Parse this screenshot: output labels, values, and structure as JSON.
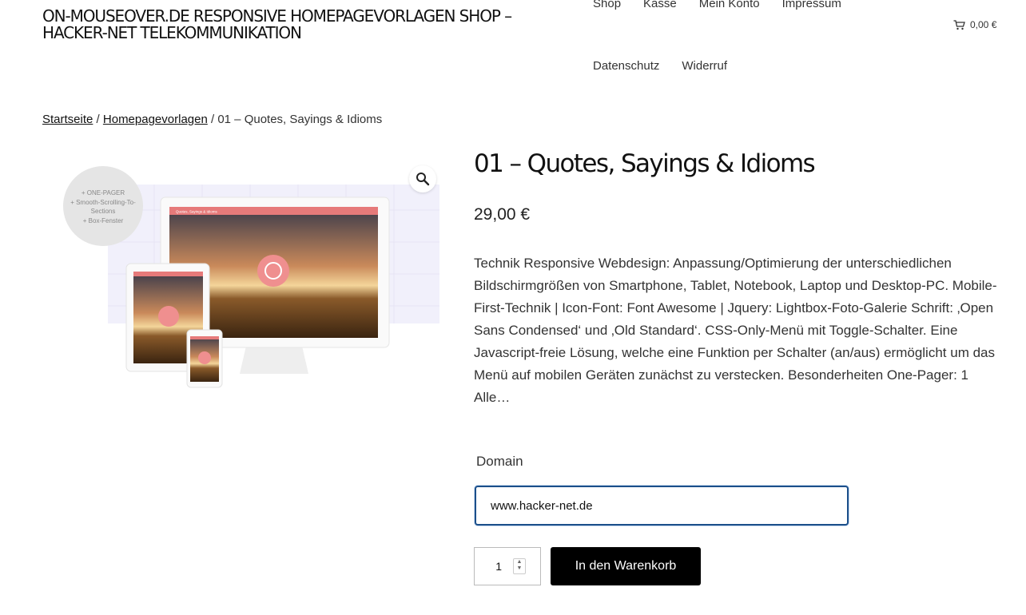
{
  "site": {
    "title": "ON-MOUSEOVER.DE RESPONSIVE HOMEPAGEVORLAGEN SHOP – HACKER-NET TELEKOMMUNIKATION"
  },
  "nav": {
    "items": [
      {
        "label": "Shop"
      },
      {
        "label": "Kasse"
      },
      {
        "label": "Mein Konto"
      },
      {
        "label": "Impressum"
      },
      {
        "label": "Datenschutz"
      },
      {
        "label": "Widerruf"
      }
    ]
  },
  "cart": {
    "total": "0,00 €",
    "icon": "cart-icon"
  },
  "breadcrumb": {
    "items": [
      "Startseite",
      "Homepagevorlagen"
    ],
    "separator": "/",
    "current": "01 – Quotes, Sayings & Idioms"
  },
  "gallery": {
    "badge_lines": [
      "+ ONE-PAGER",
      "+ Smooth-Scrolling-To-",
      "Sections",
      "+ Box-Fenster"
    ],
    "mockup_title": "Quotes, Sayings & Idioms",
    "zoom_icon": "magnifier-icon"
  },
  "product": {
    "title": "01 – Quotes, Sayings & Idioms",
    "price": "29,00 €",
    "description": "Technik Responsive Webdesign: Anpassung/Optimierung der unterschiedlichen Bildschirmgrößen von Smartphone, Tablet, Notebook, Laptop und Desktop-PC. Mobile-First-Technik | Icon-Font: Font Awesome | Jquery: Lightbox-Foto-Galerie Schrift: ‚Open Sans Condensed‘ und ‚Old Standard‘. CSS-Only-Menü mit Toggle-Schalter. Eine Javascript-freie Lösung, welche eine Funktion per Schalter (an/aus) ermöglicht um das Menü auf mobilen Geräten zunächst zu verstecken. Besonderheiten One-Pager: 1 Alle…"
  },
  "form": {
    "domain_label": "Domain",
    "domain_value": "www.hacker-net.de",
    "quantity": "1",
    "add_to_cart": "In den Warenkorb"
  }
}
